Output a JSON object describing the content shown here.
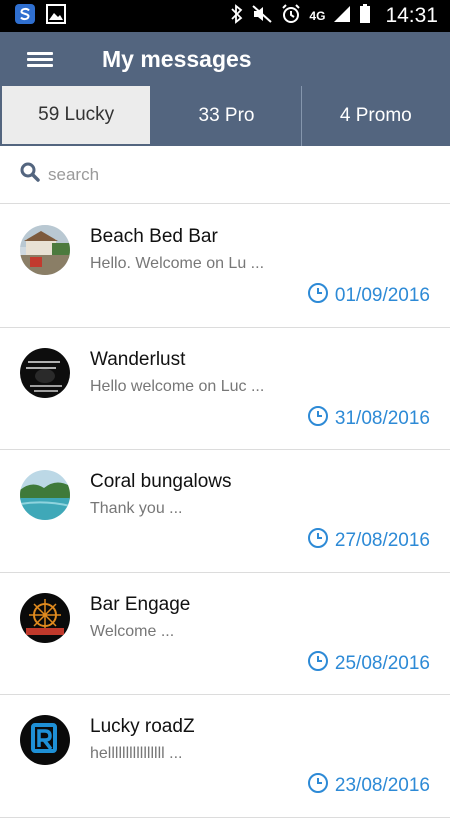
{
  "status_bar": {
    "time": "14:31",
    "network": "4G"
  },
  "app_bar": {
    "title": "My messages",
    "menu_icon": "hamburger-menu-icon"
  },
  "tabs": [
    {
      "label": "59 Lucky",
      "active": true
    },
    {
      "label": "33 Pro",
      "active": false
    },
    {
      "label": "4 Promo",
      "active": false
    }
  ],
  "search": {
    "placeholder": "search"
  },
  "messages": [
    {
      "name": "Beach Bed Bar",
      "preview": "Hello. Welcome on Lu ...",
      "date": "01/09/2016"
    },
    {
      "name": "Wanderlust",
      "preview": "Hello welcome on Luc ...",
      "date": "31/08/2016"
    },
    {
      "name": "Coral bungalows",
      "preview": "Thank you ...",
      "date": "27/08/2016"
    },
    {
      "name": "Bar Engage",
      "preview": "Welcome ...",
      "date": "25/08/2016"
    },
    {
      "name": "Lucky roadZ",
      "preview": "hellllllllllllllll ...",
      "date": "23/08/2016"
    }
  ],
  "colors": {
    "app_bar": "#53657f",
    "date": "#2d8ad6",
    "active_tab": "#ececec"
  }
}
